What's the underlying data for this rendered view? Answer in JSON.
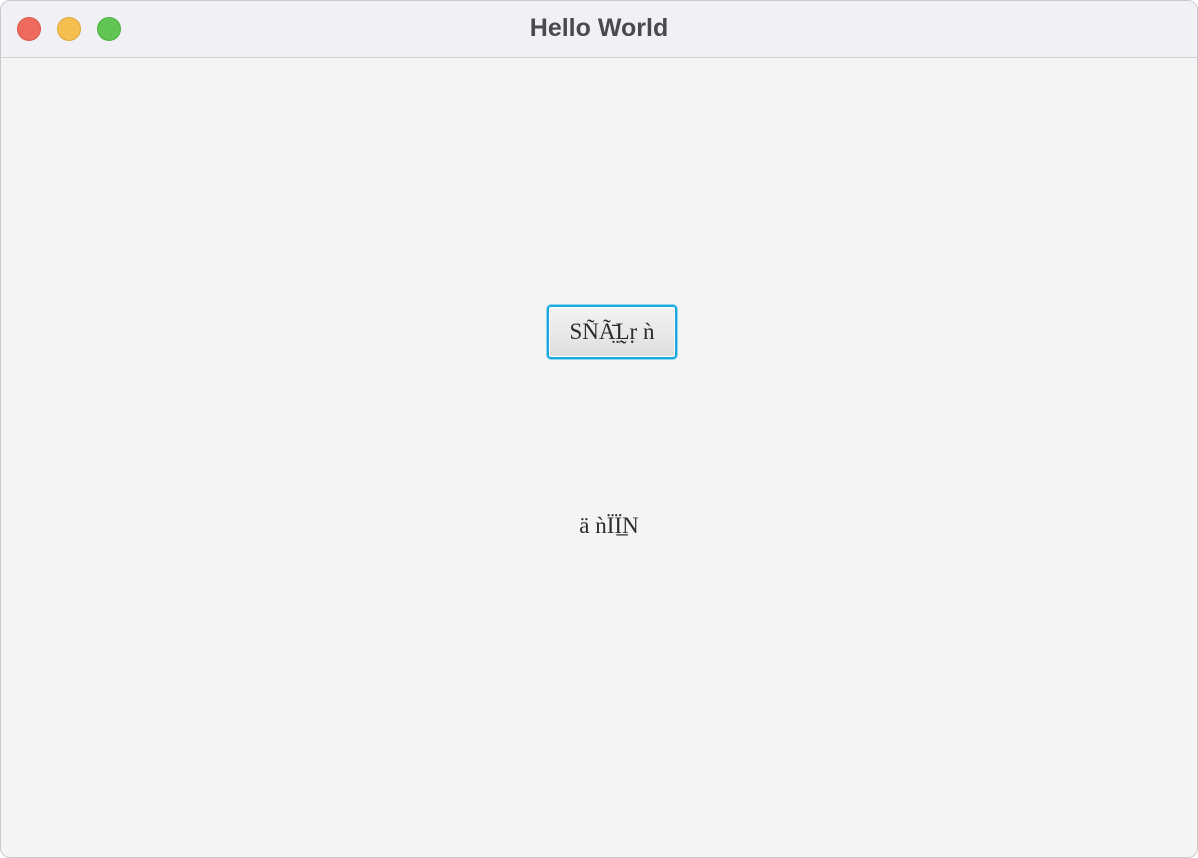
{
  "window": {
    "title": "Hello World",
    "controls": [
      "close-icon",
      "minimize-icon",
      "zoom-icon"
    ]
  },
  "main": {
    "button_label": "SÑÃ̤̄L̰ṛ ǹ",
    "output_text": "ä ǹÏÏ̲N"
  },
  "colors": {
    "close": "#ee6a5f",
    "minimize": "#f5bf4f",
    "zoom": "#61c554",
    "focus_ring": "#19a6e1",
    "background": "#f4f4f5"
  }
}
